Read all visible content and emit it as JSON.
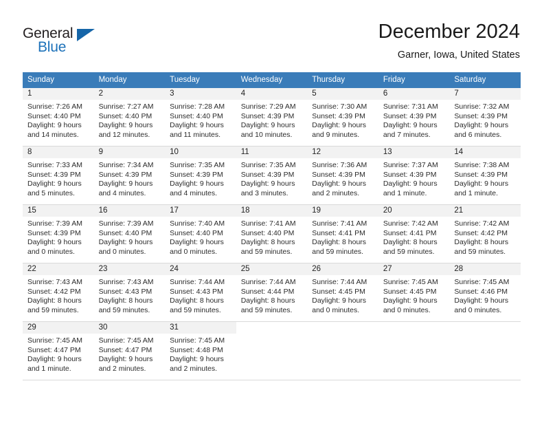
{
  "branding": {
    "logo_primary": "General",
    "logo_secondary": "Blue",
    "logo_primary_color": "#231f20",
    "logo_secondary_color": "#1c71b9",
    "logo_triangle_color": "#1565a8"
  },
  "header": {
    "title": "December 2024",
    "subtitle": "Garner, Iowa, United States"
  },
  "theme": {
    "header_row_bg": "#3a7cb9",
    "header_row_text": "#ffffff",
    "daynum_band_bg": "#f2f2f2",
    "cell_border": "#d9d9d9"
  },
  "weekdays": [
    "Sunday",
    "Monday",
    "Tuesday",
    "Wednesday",
    "Thursday",
    "Friday",
    "Saturday"
  ],
  "weeks": [
    [
      {
        "day": "1",
        "sunrise": "Sunrise: 7:26 AM",
        "sunset": "Sunset: 4:40 PM",
        "daylight1": "Daylight: 9 hours",
        "daylight2": "and 14 minutes."
      },
      {
        "day": "2",
        "sunrise": "Sunrise: 7:27 AM",
        "sunset": "Sunset: 4:40 PM",
        "daylight1": "Daylight: 9 hours",
        "daylight2": "and 12 minutes."
      },
      {
        "day": "3",
        "sunrise": "Sunrise: 7:28 AM",
        "sunset": "Sunset: 4:40 PM",
        "daylight1": "Daylight: 9 hours",
        "daylight2": "and 11 minutes."
      },
      {
        "day": "4",
        "sunrise": "Sunrise: 7:29 AM",
        "sunset": "Sunset: 4:39 PM",
        "daylight1": "Daylight: 9 hours",
        "daylight2": "and 10 minutes."
      },
      {
        "day": "5",
        "sunrise": "Sunrise: 7:30 AM",
        "sunset": "Sunset: 4:39 PM",
        "daylight1": "Daylight: 9 hours",
        "daylight2": "and 9 minutes."
      },
      {
        "day": "6",
        "sunrise": "Sunrise: 7:31 AM",
        "sunset": "Sunset: 4:39 PM",
        "daylight1": "Daylight: 9 hours",
        "daylight2": "and 7 minutes."
      },
      {
        "day": "7",
        "sunrise": "Sunrise: 7:32 AM",
        "sunset": "Sunset: 4:39 PM",
        "daylight1": "Daylight: 9 hours",
        "daylight2": "and 6 minutes."
      }
    ],
    [
      {
        "day": "8",
        "sunrise": "Sunrise: 7:33 AM",
        "sunset": "Sunset: 4:39 PM",
        "daylight1": "Daylight: 9 hours",
        "daylight2": "and 5 minutes."
      },
      {
        "day": "9",
        "sunrise": "Sunrise: 7:34 AM",
        "sunset": "Sunset: 4:39 PM",
        "daylight1": "Daylight: 9 hours",
        "daylight2": "and 4 minutes."
      },
      {
        "day": "10",
        "sunrise": "Sunrise: 7:35 AM",
        "sunset": "Sunset: 4:39 PM",
        "daylight1": "Daylight: 9 hours",
        "daylight2": "and 4 minutes."
      },
      {
        "day": "11",
        "sunrise": "Sunrise: 7:35 AM",
        "sunset": "Sunset: 4:39 PM",
        "daylight1": "Daylight: 9 hours",
        "daylight2": "and 3 minutes."
      },
      {
        "day": "12",
        "sunrise": "Sunrise: 7:36 AM",
        "sunset": "Sunset: 4:39 PM",
        "daylight1": "Daylight: 9 hours",
        "daylight2": "and 2 minutes."
      },
      {
        "day": "13",
        "sunrise": "Sunrise: 7:37 AM",
        "sunset": "Sunset: 4:39 PM",
        "daylight1": "Daylight: 9 hours",
        "daylight2": "and 1 minute."
      },
      {
        "day": "14",
        "sunrise": "Sunrise: 7:38 AM",
        "sunset": "Sunset: 4:39 PM",
        "daylight1": "Daylight: 9 hours",
        "daylight2": "and 1 minute."
      }
    ],
    [
      {
        "day": "15",
        "sunrise": "Sunrise: 7:39 AM",
        "sunset": "Sunset: 4:39 PM",
        "daylight1": "Daylight: 9 hours",
        "daylight2": "and 0 minutes."
      },
      {
        "day": "16",
        "sunrise": "Sunrise: 7:39 AM",
        "sunset": "Sunset: 4:40 PM",
        "daylight1": "Daylight: 9 hours",
        "daylight2": "and 0 minutes."
      },
      {
        "day": "17",
        "sunrise": "Sunrise: 7:40 AM",
        "sunset": "Sunset: 4:40 PM",
        "daylight1": "Daylight: 9 hours",
        "daylight2": "and 0 minutes."
      },
      {
        "day": "18",
        "sunrise": "Sunrise: 7:41 AM",
        "sunset": "Sunset: 4:40 PM",
        "daylight1": "Daylight: 8 hours",
        "daylight2": "and 59 minutes."
      },
      {
        "day": "19",
        "sunrise": "Sunrise: 7:41 AM",
        "sunset": "Sunset: 4:41 PM",
        "daylight1": "Daylight: 8 hours",
        "daylight2": "and 59 minutes."
      },
      {
        "day": "20",
        "sunrise": "Sunrise: 7:42 AM",
        "sunset": "Sunset: 4:41 PM",
        "daylight1": "Daylight: 8 hours",
        "daylight2": "and 59 minutes."
      },
      {
        "day": "21",
        "sunrise": "Sunrise: 7:42 AM",
        "sunset": "Sunset: 4:42 PM",
        "daylight1": "Daylight: 8 hours",
        "daylight2": "and 59 minutes."
      }
    ],
    [
      {
        "day": "22",
        "sunrise": "Sunrise: 7:43 AM",
        "sunset": "Sunset: 4:42 PM",
        "daylight1": "Daylight: 8 hours",
        "daylight2": "and 59 minutes."
      },
      {
        "day": "23",
        "sunrise": "Sunrise: 7:43 AM",
        "sunset": "Sunset: 4:43 PM",
        "daylight1": "Daylight: 8 hours",
        "daylight2": "and 59 minutes."
      },
      {
        "day": "24",
        "sunrise": "Sunrise: 7:44 AM",
        "sunset": "Sunset: 4:43 PM",
        "daylight1": "Daylight: 8 hours",
        "daylight2": "and 59 minutes."
      },
      {
        "day": "25",
        "sunrise": "Sunrise: 7:44 AM",
        "sunset": "Sunset: 4:44 PM",
        "daylight1": "Daylight: 8 hours",
        "daylight2": "and 59 minutes."
      },
      {
        "day": "26",
        "sunrise": "Sunrise: 7:44 AM",
        "sunset": "Sunset: 4:45 PM",
        "daylight1": "Daylight: 9 hours",
        "daylight2": "and 0 minutes."
      },
      {
        "day": "27",
        "sunrise": "Sunrise: 7:45 AM",
        "sunset": "Sunset: 4:45 PM",
        "daylight1": "Daylight: 9 hours",
        "daylight2": "and 0 minutes."
      },
      {
        "day": "28",
        "sunrise": "Sunrise: 7:45 AM",
        "sunset": "Sunset: 4:46 PM",
        "daylight1": "Daylight: 9 hours",
        "daylight2": "and 0 minutes."
      }
    ],
    [
      {
        "day": "29",
        "sunrise": "Sunrise: 7:45 AM",
        "sunset": "Sunset: 4:47 PM",
        "daylight1": "Daylight: 9 hours",
        "daylight2": "and 1 minute."
      },
      {
        "day": "30",
        "sunrise": "Sunrise: 7:45 AM",
        "sunset": "Sunset: 4:47 PM",
        "daylight1": "Daylight: 9 hours",
        "daylight2": "and 2 minutes."
      },
      {
        "day": "31",
        "sunrise": "Sunrise: 7:45 AM",
        "sunset": "Sunset: 4:48 PM",
        "daylight1": "Daylight: 9 hours",
        "daylight2": "and 2 minutes."
      },
      {
        "day": "",
        "sunrise": "",
        "sunset": "",
        "daylight1": "",
        "daylight2": ""
      },
      {
        "day": "",
        "sunrise": "",
        "sunset": "",
        "daylight1": "",
        "daylight2": ""
      },
      {
        "day": "",
        "sunrise": "",
        "sunset": "",
        "daylight1": "",
        "daylight2": ""
      },
      {
        "day": "",
        "sunrise": "",
        "sunset": "",
        "daylight1": "",
        "daylight2": ""
      }
    ]
  ]
}
